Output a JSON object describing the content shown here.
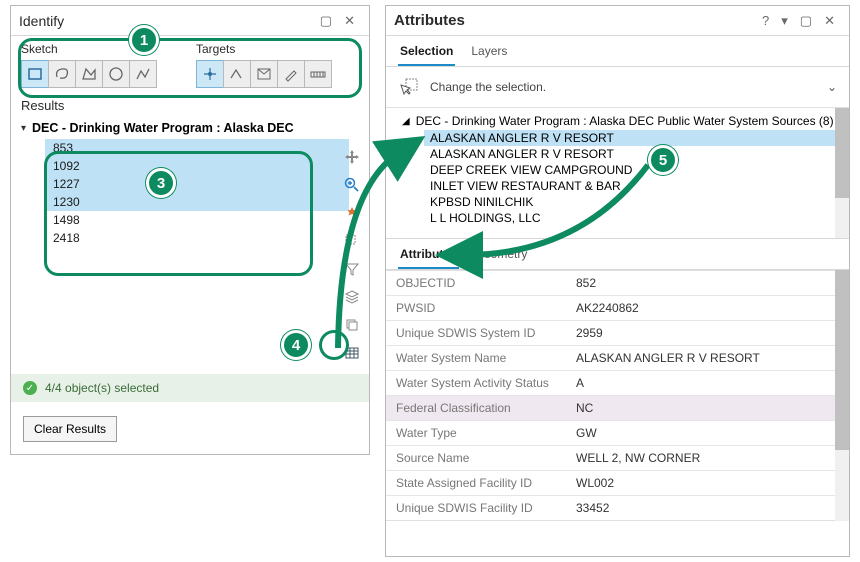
{
  "identify": {
    "title": "Identify",
    "sketch_label": "Sketch",
    "targets_label": "Targets",
    "results_label": "Results",
    "layer": "DEC - Drinking Water Program : Alaska DEC",
    "rows": [
      "853",
      "1092",
      "1227",
      "1230",
      "1498",
      "2418"
    ],
    "selected_rows": [
      0,
      1,
      2,
      3
    ],
    "status": "4/4 object(s) selected",
    "clear_label": "Clear Results"
  },
  "attributes": {
    "title": "Attributes",
    "tabs": {
      "selection": "Selection",
      "layers": "Layers"
    },
    "change_selection": "Change the selection.",
    "tree_title": "DEC - Drinking Water Program : Alaska DEC Public Water System Sources (8)",
    "items": [
      "ALASKAN ANGLER R V RESORT",
      "ALASKAN ANGLER R V RESORT",
      "DEEP CREEK VIEW CAMPGROUND",
      "INLET VIEW RESTAURANT & BAR",
      "KPBSD NINILCHIK",
      "L L HOLDINGS, LLC"
    ],
    "selected_item": 0,
    "subtabs": {
      "attributes": "Attributes",
      "geometry": "Geometry"
    },
    "grid": [
      {
        "k": "OBJECTID",
        "v": "852"
      },
      {
        "k": "PWSID",
        "v": "AK2240862"
      },
      {
        "k": "Unique SDWIS System ID",
        "v": "2959"
      },
      {
        "k": "Water System Name",
        "v": "ALASKAN ANGLER R V RESORT"
      },
      {
        "k": "Water System Activity Status",
        "v": "A"
      },
      {
        "k": "Federal Classification",
        "v": "NC"
      },
      {
        "k": "Water Type",
        "v": "GW"
      },
      {
        "k": "Source Name",
        "v": "WELL 2, NW CORNER"
      },
      {
        "k": "State Assigned Facility ID",
        "v": "WL002"
      },
      {
        "k": "Unique SDWIS Facility ID",
        "v": "33452"
      }
    ],
    "highlight_row": 5
  },
  "callouts": {
    "c1": "1",
    "c3": "3",
    "c4": "4",
    "c5": "5"
  }
}
